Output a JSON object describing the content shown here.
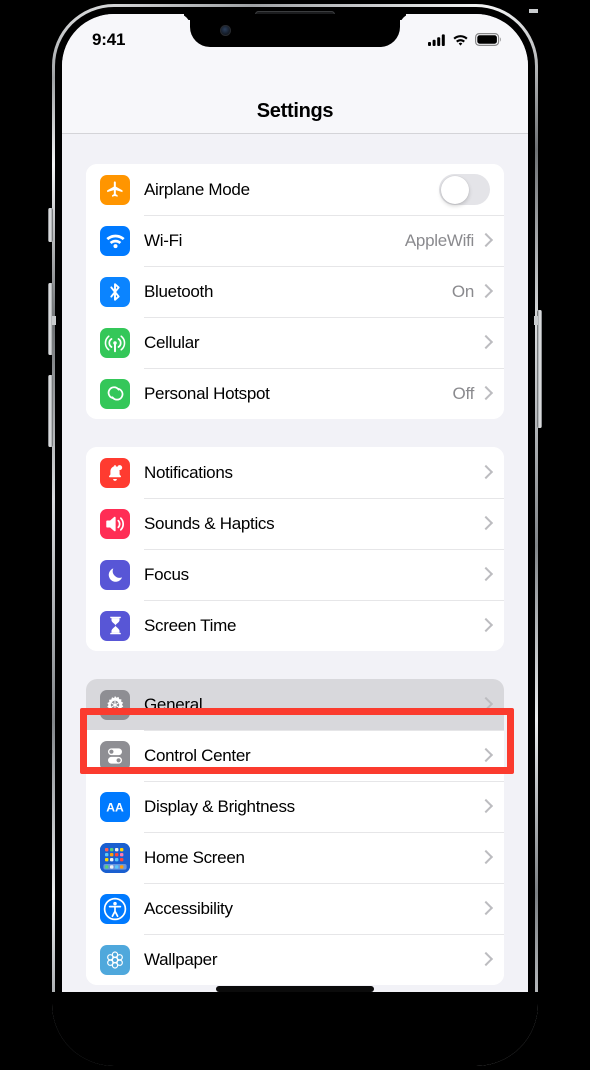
{
  "device": {
    "name": "iphone-13-pro",
    "frame_color": "#b9bcbe",
    "screen_background": "#f2f2f7"
  },
  "status_bar": {
    "time": "9:41",
    "cellular_icon": "signal-bars-icon",
    "wifi_icon": "wifi-icon",
    "battery_icon": "battery-full-icon"
  },
  "nav": {
    "title": "Settings"
  },
  "highlight": {
    "target": "General",
    "color": "#fb3b2e",
    "border_width": 7
  },
  "colors": {
    "orange": "#FF9500",
    "blue": "#007AFF",
    "green": "#34C759",
    "red": "#FF3B30",
    "pink": "#FF2D55",
    "indigo": "#5856D6",
    "gray": "#8E8E93",
    "home_screen_blue": "#1A5FD0",
    "teal": "#4FA8DC",
    "chevron": "#bcbcc0",
    "value_text": "#8a8a8e"
  },
  "groups": [
    {
      "id": "connectivity",
      "rows": [
        {
          "label": "Airplane Mode",
          "icon": "airplane-icon",
          "icon_color": "#FF9500",
          "accessory": "toggle",
          "toggle_on": false,
          "value": ""
        },
        {
          "label": "Wi-Fi",
          "icon": "wifi-icon",
          "icon_color": "#007AFF",
          "accessory": "chevron",
          "value": "AppleWifi"
        },
        {
          "label": "Bluetooth",
          "icon": "bluetooth-icon",
          "icon_color": "#0B84FF",
          "accessory": "chevron",
          "value": "On"
        },
        {
          "label": "Cellular",
          "icon": "cellular-antenna-icon",
          "icon_color": "#34C759",
          "accessory": "chevron",
          "value": ""
        },
        {
          "label": "Personal Hotspot",
          "icon": "hotspot-link-icon",
          "icon_color": "#34C759",
          "accessory": "chevron",
          "value": "Off"
        }
      ]
    },
    {
      "id": "alerts",
      "rows": [
        {
          "label": "Notifications",
          "icon": "bell-icon",
          "icon_color": "#FF3B30",
          "accessory": "chevron",
          "value": ""
        },
        {
          "label": "Sounds & Haptics",
          "icon": "speaker-waves-icon",
          "icon_color": "#FF2D55",
          "accessory": "chevron",
          "value": ""
        },
        {
          "label": "Focus",
          "icon": "moon-icon",
          "icon_color": "#5856D6",
          "accessory": "chevron",
          "value": ""
        },
        {
          "label": "Screen Time",
          "icon": "hourglass-icon",
          "icon_color": "#5856D6",
          "accessory": "chevron",
          "value": ""
        }
      ]
    },
    {
      "id": "system",
      "rows": [
        {
          "label": "General",
          "icon": "gear-icon",
          "icon_color": "#8E8E93",
          "accessory": "chevron",
          "value": "",
          "highlighted": true
        },
        {
          "label": "Control Center",
          "icon": "control-center-toggles-icon",
          "icon_color": "#8E8E93",
          "accessory": "chevron",
          "value": ""
        },
        {
          "label": "Display & Brightness",
          "icon": "display-aa-icon",
          "icon_color": "#007AFF",
          "accessory": "chevron",
          "value": ""
        },
        {
          "label": "Home Screen",
          "icon": "home-screen-grid-icon",
          "icon_color": "#1A5FD0",
          "accessory": "chevron",
          "value": ""
        },
        {
          "label": "Accessibility",
          "icon": "accessibility-person-icon",
          "icon_color": "#007AFF",
          "accessory": "chevron",
          "value": ""
        },
        {
          "label": "Wallpaper",
          "icon": "wallpaper-flower-icon",
          "icon_color": "#4FA8DC",
          "accessory": "chevron",
          "value": ""
        }
      ]
    }
  ]
}
